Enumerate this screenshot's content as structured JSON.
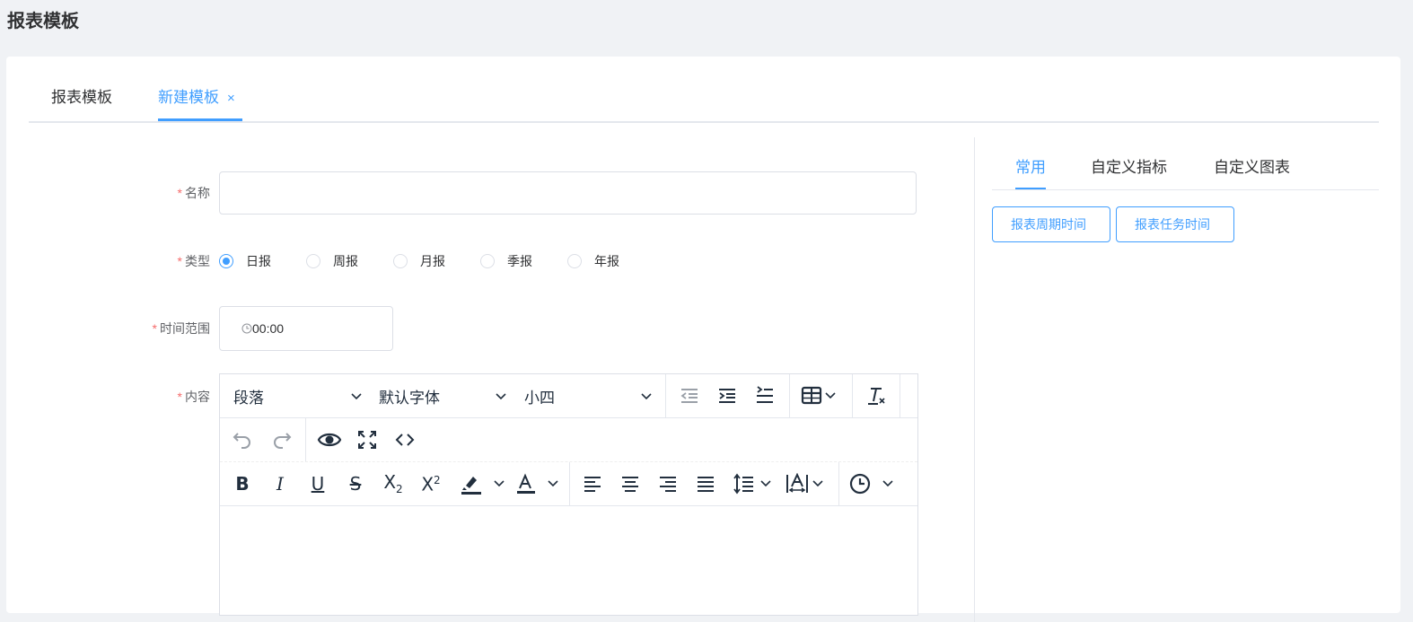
{
  "page": {
    "title": "报表模板"
  },
  "tabs": [
    {
      "label": "报表模板",
      "active": false
    },
    {
      "label": "新建模板",
      "active": true,
      "closable": true,
      "close_glyph": "×"
    }
  ],
  "form": {
    "name": {
      "label": "名称",
      "value": "",
      "placeholder": ""
    },
    "type": {
      "label": "类型",
      "options": [
        "日报",
        "周报",
        "月报",
        "季报",
        "年报"
      ],
      "selected": "日报"
    },
    "time_range": {
      "label": "时间范围",
      "value": "00:00",
      "icon": "clock-icon"
    },
    "content": {
      "label": "内容"
    },
    "required_marker": "*"
  },
  "editor": {
    "block_format": "段落",
    "font_family": "默认字体",
    "font_size": "小四",
    "toolbar_icons": [
      "outdent-icon",
      "indent-icon",
      "line-spacing-indent-icon",
      "table-icon",
      "clear-format-icon",
      "undo-icon",
      "redo-icon",
      "preview-icon",
      "fullscreen-icon",
      "code-icon",
      "bold-icon",
      "italic-icon",
      "underline-icon",
      "strikethrough-icon",
      "subscript-icon",
      "superscript-icon",
      "highlight-icon",
      "font-color-icon",
      "align-left-icon",
      "align-center-icon",
      "align-right-icon",
      "justify-icon",
      "line-height-icon",
      "letter-spacing-icon",
      "time-icon"
    ],
    "colors": {
      "icon": "#222f3e",
      "disabled": "#9aa0a8"
    }
  },
  "side_panel": {
    "tabs": [
      {
        "label": "常用",
        "active": true
      },
      {
        "label": "自定义指标",
        "active": false
      },
      {
        "label": "自定义图表",
        "active": false
      }
    ],
    "buttons": [
      "报表周期时间",
      "报表任务时间"
    ]
  },
  "colors": {
    "primary": "#409eff",
    "danger": "#f56c6c",
    "border": "#dcdfe6",
    "background": "#f0f2f5"
  }
}
